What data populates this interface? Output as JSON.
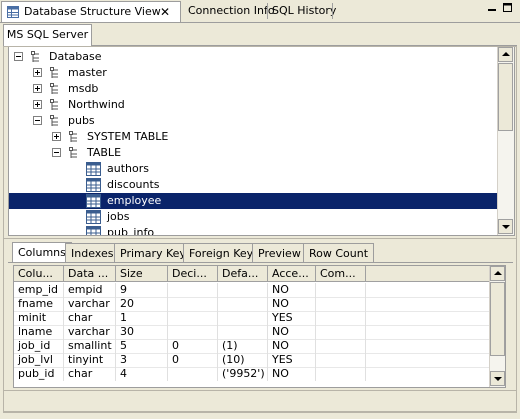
{
  "window": {
    "tabs": [
      {
        "label": "Database Structure View",
        "active": true,
        "close": "✕"
      },
      {
        "label": "Connection Info",
        "active": false
      },
      {
        "label": "SQL History",
        "active": false
      }
    ]
  },
  "server_tab": {
    "label": "MS SQL Server"
  },
  "tree": {
    "items": [
      {
        "label": "Database",
        "expander": "minus",
        "icon": "tree-icon"
      },
      {
        "label": "master",
        "expander": "plus",
        "icon": "tree-icon"
      },
      {
        "label": "msdb",
        "expander": "plus",
        "icon": "tree-icon"
      },
      {
        "label": "Northwind",
        "expander": "plus",
        "icon": "tree-icon"
      },
      {
        "label": "pubs",
        "expander": "minus",
        "icon": "tree-icon"
      },
      {
        "label": "SYSTEM TABLE",
        "expander": "plus",
        "icon": "tree-icon"
      },
      {
        "label": "TABLE",
        "expander": "minus",
        "icon": "tree-icon"
      },
      {
        "label": "authors",
        "icon": "table-icon"
      },
      {
        "label": "discounts",
        "icon": "table-icon"
      },
      {
        "label": "employee",
        "icon": "table-icon",
        "selected": true
      },
      {
        "label": "jobs",
        "icon": "table-icon"
      },
      {
        "label": "pub_info",
        "icon": "table-icon"
      }
    ]
  },
  "detail_tabs": [
    "Columns",
    "Indexes",
    "Primary Key",
    "Foreign Key",
    "Preview",
    "Row Count"
  ],
  "columns_table": {
    "headers": [
      "Colu...",
      "Data ...",
      "Size",
      "Deci...",
      "Defa...",
      "Acce...",
      "Com..."
    ],
    "rows": [
      [
        "emp_id",
        "empid",
        "9",
        "",
        "",
        "NO",
        ""
      ],
      [
        "fname",
        "varchar",
        "20",
        "",
        "",
        "NO",
        ""
      ],
      [
        "minit",
        "char",
        "1",
        "",
        "",
        "YES",
        ""
      ],
      [
        "lname",
        "varchar",
        "30",
        "",
        "",
        "NO",
        ""
      ],
      [
        "job_id",
        "smallint",
        "5",
        "0",
        "(1)",
        "NO",
        ""
      ],
      [
        "job_lvl",
        "tinyint",
        "3",
        "0",
        "(10)",
        "YES",
        ""
      ],
      [
        "pub_id",
        "char",
        "4",
        "",
        "('9952')",
        "NO",
        ""
      ]
    ]
  },
  "colors": {
    "selection": "#0a246a",
    "tab_bg": "#ece9d8"
  }
}
